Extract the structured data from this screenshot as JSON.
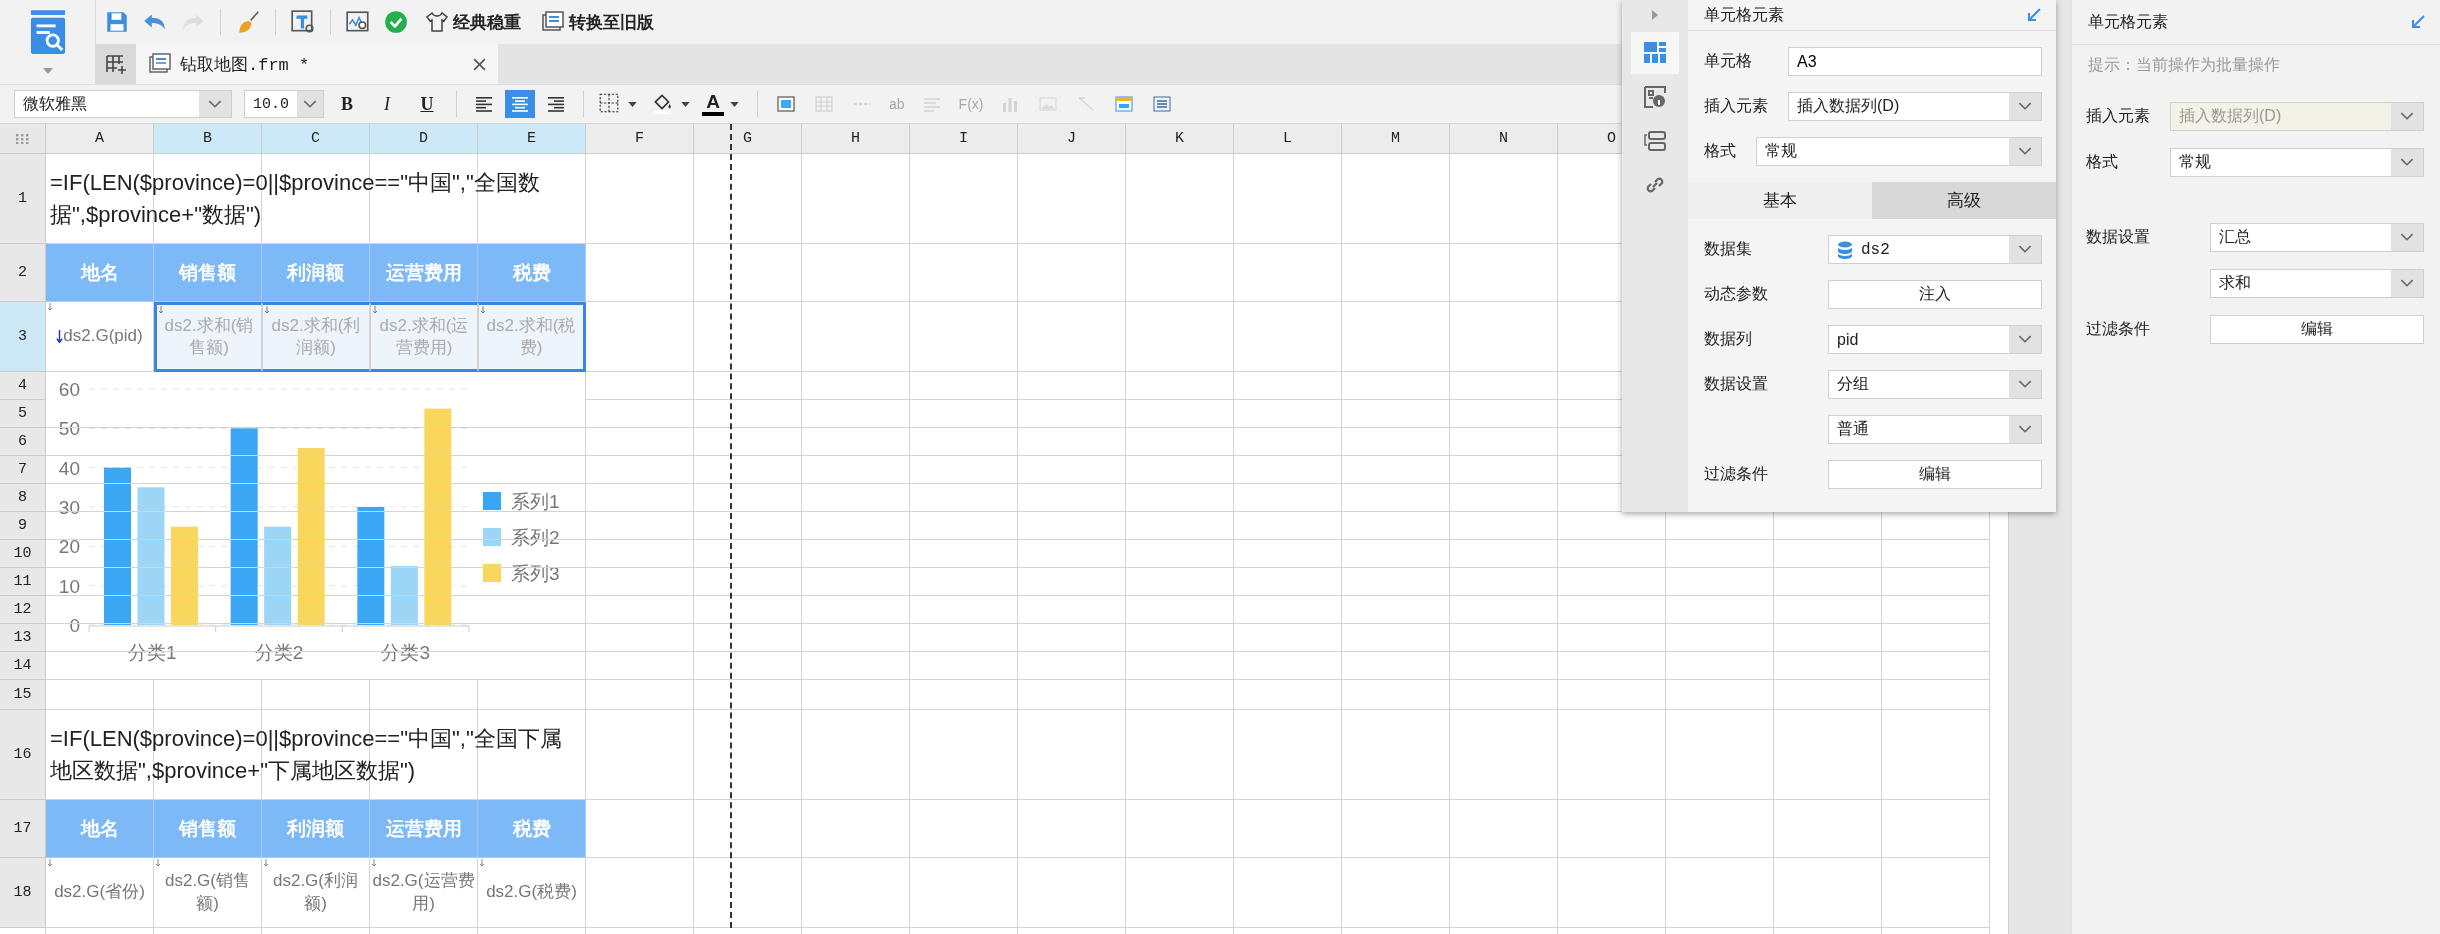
{
  "toolbar": {
    "buttons": [
      {
        "kind": "save",
        "disabled": false
      },
      {
        "kind": "undo",
        "disabled": false
      },
      {
        "kind": "redo",
        "disabled": true
      },
      {
        "kind": "brush",
        "disabled": false
      },
      {
        "kind": "text-style",
        "disabled": false
      },
      {
        "kind": "preview",
        "disabled": false
      },
      {
        "kind": "check",
        "disabled": false
      }
    ],
    "text_buttons": [
      {
        "kind": "theme",
        "label": "经典稳重"
      },
      {
        "kind": "convert",
        "label": "转换至旧版"
      }
    ]
  },
  "file_tab": {
    "label": "钻取地图.frm *",
    "selected": true
  },
  "format_bar": {
    "font": "微软雅黑",
    "size": "10.0",
    "styles": [
      {
        "kind": "bold",
        "label": "B"
      },
      {
        "kind": "italic",
        "label": "I"
      },
      {
        "kind": "underline",
        "label": "U"
      }
    ],
    "align": [
      {
        "kind": "left",
        "selected": false
      },
      {
        "kind": "center",
        "selected": true
      },
      {
        "kind": "right",
        "selected": false
      }
    ],
    "font_color_label": "A",
    "tools": [
      {
        "kind": "merge",
        "disabled": false
      },
      {
        "kind": "grid",
        "disabled": true
      },
      {
        "kind": "dash",
        "disabled": true
      },
      {
        "kind": "text",
        "label": "ab",
        "disabled": true
      },
      {
        "kind": "lines",
        "disabled": true
      },
      {
        "kind": "text",
        "label": "F(x)",
        "disabled": true
      },
      {
        "kind": "bars",
        "disabled": true
      },
      {
        "kind": "image",
        "disabled": true
      },
      {
        "kind": "slash",
        "disabled": true
      },
      {
        "kind": "panel",
        "disabled": false
      },
      {
        "kind": "list",
        "disabled": false
      }
    ]
  },
  "sheet": {
    "columns": [
      {
        "label": "A",
        "selected": false
      },
      {
        "label": "B",
        "selected": true
      },
      {
        "label": "C",
        "selected": true
      },
      {
        "label": "D",
        "selected": true
      },
      {
        "label": "E",
        "selected": true
      },
      {
        "label": "F",
        "selected": false
      },
      {
        "label": "G",
        "selected": false
      },
      {
        "label": "H",
        "selected": false
      },
      {
        "label": "I",
        "selected": false
      },
      {
        "label": "J",
        "selected": false
      },
      {
        "label": "K",
        "selected": false
      },
      {
        "label": "L",
        "selected": false
      },
      {
        "label": "M",
        "selected": false
      },
      {
        "label": "N",
        "selected": false
      },
      {
        "label": "O",
        "selected": false
      }
    ],
    "rows": [
      {
        "number": "1",
        "selected": false,
        "kind": "formula",
        "text": "=IF(LEN($province)=0||$province==\"中国\",\"全国数据\",$province+\"数据\")"
      },
      {
        "number": "2",
        "selected": false,
        "kind": "header",
        "cells": [
          "地名",
          "销售额",
          "利润额",
          "运营费用",
          "税费"
        ]
      },
      {
        "number": "3",
        "selected": true,
        "kind": "data",
        "cells": [
          {
            "text": "ds2.G(pid)",
            "selected": false,
            "expand": true
          },
          {
            "text": "ds2.求和(销售额)",
            "selected": true,
            "expand": false
          },
          {
            "text": "ds2.求和(利润额)",
            "selected": true,
            "expand": false
          },
          {
            "text": "ds2.求和(运营费用)",
            "selected": true,
            "expand": false
          },
          {
            "text": "ds2.求和(税费)",
            "selected": true,
            "expand": false
          }
        ]
      },
      {
        "number": "4",
        "selected": false,
        "kind": "chart"
      },
      {
        "number": "5",
        "selected": false,
        "kind": "chart"
      },
      {
        "number": "6",
        "selected": false,
        "kind": "chart"
      },
      {
        "number": "7",
        "selected": false,
        "kind": "chart"
      },
      {
        "number": "8",
        "selected": false,
        "kind": "chart"
      },
      {
        "number": "9",
        "selected": false,
        "kind": "chart"
      },
      {
        "number": "10",
        "selected": false,
        "kind": "chart"
      },
      {
        "number": "11",
        "selected": false,
        "kind": "chart"
      },
      {
        "number": "12",
        "selected": false,
        "kind": "chart"
      },
      {
        "number": "13",
        "selected": false,
        "kind": "chart"
      },
      {
        "number": "14",
        "selected": false,
        "kind": "chart"
      },
      {
        "number": "15",
        "selected": false,
        "kind": "empty"
      },
      {
        "number": "16",
        "selected": false,
        "kind": "formula",
        "text": "=IF(LEN($province)=0||$province==\"中国\",\"全国下属地区数据\",$province+\"下属地区数据\")"
      },
      {
        "number": "17",
        "selected": false,
        "kind": "header",
        "cells": [
          "地名",
          "销售额",
          "利润额",
          "运营费用",
          "税费"
        ]
      },
      {
        "number": "18",
        "selected": false,
        "kind": "data",
        "cells": [
          {
            "text": "ds2.G(省份)",
            "selected": false,
            "expand": false
          },
          {
            "text": "ds2.G(销售额)",
            "selected": false,
            "expand": false
          },
          {
            "text": "ds2.G(利润额)",
            "selected": false,
            "expand": false
          },
          {
            "text": "ds2.G(运营费用)",
            "selected": false,
            "expand": false
          },
          {
            "text": "ds2.G(税费)",
            "selected": false,
            "expand": false
          }
        ]
      }
    ],
    "chart": {
      "chart_data": {
        "type": "bar",
        "categories": [
          "分类1",
          "分类2",
          "分类3"
        ],
        "series": [
          {
            "name": "系列1",
            "color": "#3aa6f4",
            "values": [
              40,
              50,
              30
            ]
          },
          {
            "name": "系列2",
            "color": "#9bd6f7",
            "values": [
              35,
              25,
              15
            ]
          },
          {
            "name": "系列3",
            "color": "#fad75c",
            "values": [
              25,
              45,
              55
            ]
          }
        ],
        "ylim": [
          0,
          60
        ],
        "yticks": [
          0,
          10,
          20,
          30,
          40,
          50,
          60
        ],
        "grid": true,
        "legend": true
      }
    }
  },
  "cell_panel": {
    "title": "单元格元素",
    "rail": [
      {
        "kind": "cell",
        "selected": true
      },
      {
        "kind": "info",
        "selected": false
      },
      {
        "kind": "widget",
        "selected": false
      },
      {
        "kind": "link",
        "selected": false
      }
    ],
    "fields": [
      {
        "kind": "input",
        "label": "单元格",
        "value": "A3"
      },
      {
        "kind": "select",
        "label": "插入元素",
        "value": "插入数据列(D)"
      },
      {
        "kind": "select",
        "label": "格式",
        "value": "常规"
      }
    ],
    "tabs": [
      {
        "label": "基本",
        "selected": true
      },
      {
        "label": "高级",
        "selected": false
      }
    ],
    "data_fields": [
      {
        "kind": "dataset",
        "label": "数据集",
        "value": "ds2"
      },
      {
        "kind": "button",
        "label": "动态参数",
        "value": "注入"
      },
      {
        "kind": "select",
        "label": "数据列",
        "value": "pid"
      },
      {
        "kind": "select",
        "label": "数据设置",
        "value": "分组"
      },
      {
        "kind": "select",
        "value": "普通"
      },
      {
        "kind": "button",
        "label": "过滤条件",
        "value": "编辑"
      }
    ]
  },
  "side_panel": {
    "title": "单元格元素",
    "hint": "提示：当前操作为批量操作",
    "fields": [
      {
        "kind": "select",
        "label": "插入元素",
        "value": "插入数据列(D)",
        "disabled": true
      },
      {
        "kind": "select",
        "label": "格式",
        "value": "常规",
        "disabled": false
      }
    ],
    "data_fields": [
      {
        "kind": "select",
        "label": "数据设置",
        "value": "汇总",
        "disabled": false
      },
      {
        "kind": "select",
        "value": "求和",
        "disabled": false
      },
      {
        "kind": "button",
        "label": "过滤条件",
        "value": "编辑",
        "disabled": false
      }
    ]
  }
}
